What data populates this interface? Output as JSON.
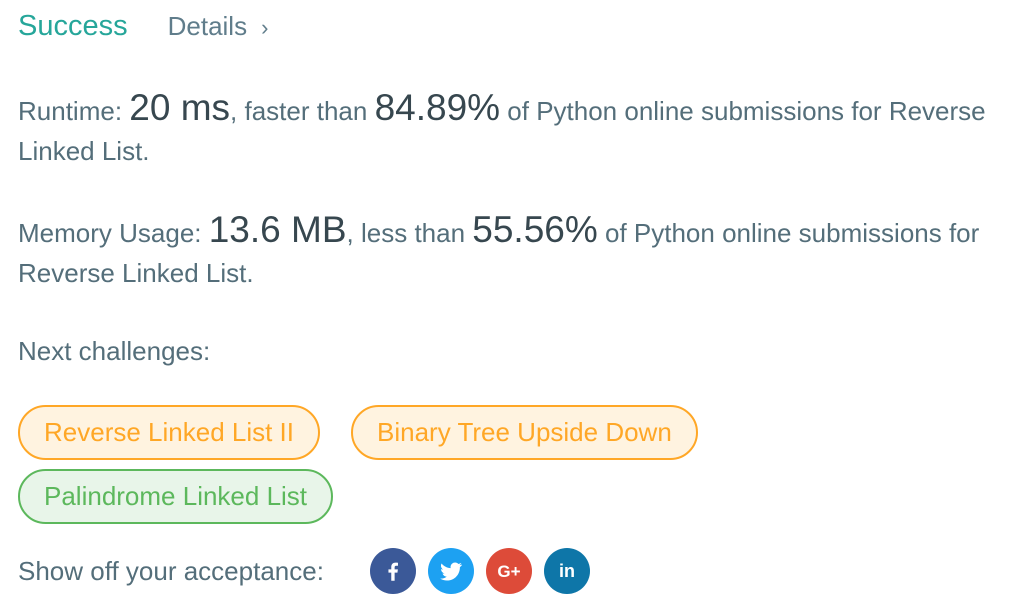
{
  "header": {
    "status": "Success",
    "details_label": "Details",
    "status_color": "#26a69a"
  },
  "runtime": {
    "label": "Runtime: ",
    "value": "20 ms",
    "comparison": ", faster than ",
    "percent": "84.89%",
    "suffix": " of Python online submissions for Reverse Linked List."
  },
  "memory": {
    "label": "Memory Usage: ",
    "value": "13.6 MB",
    "comparison": ", less than ",
    "percent": "55.56%",
    "suffix": " of Python online submissions for Reverse Linked List."
  },
  "next": {
    "label": "Next challenges:",
    "challenges": [
      {
        "title": "Reverse Linked List II",
        "difficulty": "medium",
        "color": "#ffa726"
      },
      {
        "title": "Binary Tree Upside Down",
        "difficulty": "medium",
        "color": "#ffa726"
      },
      {
        "title": "Palindrome Linked List",
        "difficulty": "easy",
        "color": "#5cb85c"
      }
    ]
  },
  "share": {
    "label": "Show off your acceptance:",
    "networks": [
      {
        "name": "facebook",
        "icon": "facebook-icon",
        "color": "#3b5998",
        "glyph": "f"
      },
      {
        "name": "twitter",
        "icon": "twitter-icon",
        "color": "#1da1f2"
      },
      {
        "name": "google-plus",
        "icon": "google-plus-icon",
        "color": "#dd4b39",
        "glyph": "G+"
      },
      {
        "name": "linkedin",
        "icon": "linkedin-icon",
        "color": "#0e76a8",
        "glyph": "in"
      }
    ]
  }
}
